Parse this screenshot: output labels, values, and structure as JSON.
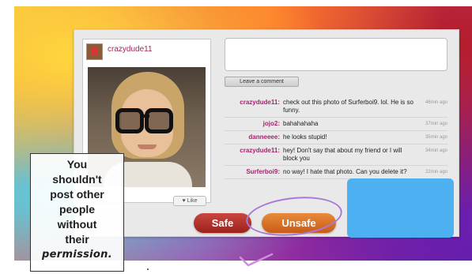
{
  "photo_post": {
    "username": "crazydude11",
    "like_label": "Like",
    "like_icon": "heart-icon"
  },
  "comment_form": {
    "input_value": "",
    "button_label": "Leave a comment"
  },
  "comments": [
    {
      "user": "crazydude11:",
      "text": "check out this photo of Surferboi9. lol. He is so funny.",
      "time": "46min ago"
    },
    {
      "user": "jojo2:",
      "text": "bahahahaha",
      "time": "37min ago"
    },
    {
      "user": "danneeee:",
      "text": "he looks stupid!",
      "time": "35min ago"
    },
    {
      "user": "crazydude11:",
      "text": "hey! Don't say that about my friend or I will block you",
      "time": "34min ago"
    },
    {
      "user": "Surferboi9:",
      "text": "no way! I hate that photo. Can you delete it?",
      "time": "22min ago"
    }
  ],
  "choices": {
    "safe_label": "Safe",
    "unsafe_label": "Unsafe"
  },
  "caption": {
    "lines": [
      "You",
      "shouldn't",
      "post other",
      "people",
      "without",
      "their",
      "permission."
    ]
  },
  "colors": {
    "username": "#a0275e",
    "safe": "#b8342c",
    "unsafe": "#de7a2c",
    "annotation": "#a879d6",
    "blue_box": "#4db0f0"
  }
}
